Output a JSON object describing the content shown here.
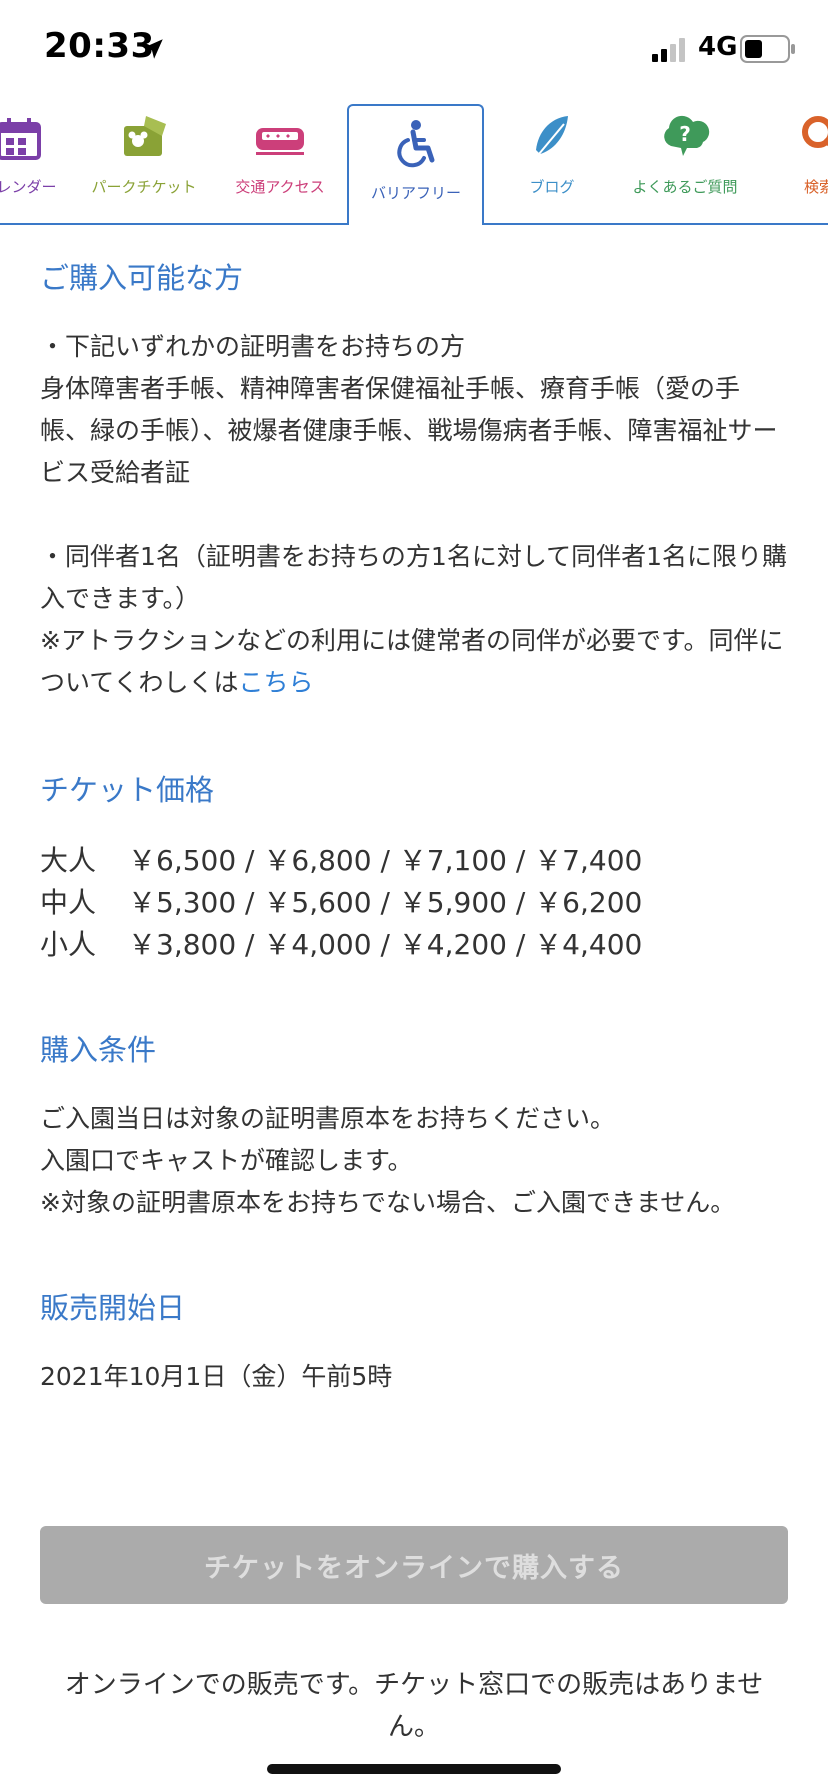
{
  "status_bar": {
    "time": "20:33",
    "network": "4G"
  },
  "tabs": [
    {
      "label": "カレンダー",
      "icon": "calendar-icon",
      "color": "#7b3fa8"
    },
    {
      "label": "パークチケット",
      "icon": "park-ticket-icon",
      "color": "#8aa236"
    },
    {
      "label": "交通アクセス",
      "icon": "train-icon",
      "color": "#cc3f7a"
    },
    {
      "label": "バリアフリー",
      "icon": "wheelchair-icon",
      "color": "#3a62b8",
      "active": true
    },
    {
      "label": "ブログ",
      "icon": "feather-icon",
      "color": "#3c8fc8"
    },
    {
      "label": "よくあるご質問",
      "icon": "question-cloud-icon",
      "color": "#3f9a5a"
    },
    {
      "label": "検索",
      "icon": "search-icon",
      "color": "#d9622a"
    }
  ],
  "sections": {
    "eligible": {
      "heading": "ご購入可能な方",
      "para1": "・下記いずれかの証明書をお持ちの方\n身体障害者手帳、精神障害者保健福祉手帳、療育手帳（愛の手帳、緑の手帳）、被爆者健康手帳、戦場傷病者手帳、障害福祉サービス受給者証",
      "para2": "・同伴者1名（証明書をお持ちの方1名に対して同伴者1名に限り購入できます。）\n※アトラクションなどの利用には健常者の同伴が必要です。同伴についてくわしくは",
      "link_text": "こちら"
    },
    "price": {
      "heading": "チケット価格",
      "rows": [
        {
          "label": "大人",
          "prices": "￥6,500 / ￥6,800 / ￥7,100 / ￥7,400"
        },
        {
          "label": "中人",
          "prices": "￥5,300 / ￥5,600 / ￥5,900 / ￥6,200"
        },
        {
          "label": "小人",
          "prices": "￥3,800 / ￥4,000 / ￥4,200 / ￥4,400"
        }
      ]
    },
    "conditions": {
      "heading": "購入条件",
      "text": "ご入園当日は対象の証明書原本をお持ちください。\n入園口でキャストが確認します。\n※対象の証明書原本をお持ちでない場合、ご入園できません。"
    },
    "sale_start": {
      "heading": "販売開始日",
      "text": "2021年10月1日（金）午前5時"
    }
  },
  "buy_button": {
    "label": "チケットをオンラインで購入する",
    "disabled": true
  },
  "note": "オンラインでの販売です。チケット窓口での販売はありません。",
  "colors": {
    "accent": "#3a79c8",
    "link": "#2f7fd6",
    "button_disabled": "#ababab"
  }
}
